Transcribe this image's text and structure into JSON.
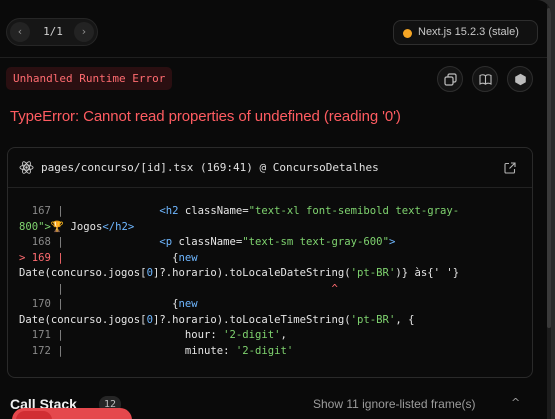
{
  "nav": {
    "prev_icon": "‹",
    "next_icon": "›",
    "page_count": "1/1"
  },
  "version": {
    "label": "Next.js 15.2.3 (stale)",
    "status_color": "#f5a524"
  },
  "error": {
    "badge": "Unhandled Runtime Error",
    "message": "TypeError: Cannot read properties of undefined (reading '0')"
  },
  "actions": {
    "copy_icon": "copy-icon",
    "docs_icon": "book-icon",
    "node_icon": "nodejs-icon"
  },
  "frame": {
    "path": "pages/concurso/[id].tsx (169:41) @ ConcursoDetalhes",
    "lines": [
      {
        "no": "  167 |",
        "segments": [
          {
            "t": "               ",
            "c": ""
          },
          {
            "t": "<h2 ",
            "c": "tag"
          },
          {
            "t": "className=",
            "c": ""
          },
          {
            "t": "\"text-xl font-semibold text-gray-",
            "c": "str"
          }
        ]
      },
      {
        "no": "",
        "segments": [
          {
            "t": "800\">",
            "c": "str"
          },
          {
            "t": "🏆 Jogos",
            "c": ""
          },
          {
            "t": "</h2>",
            "c": "tag"
          }
        ]
      },
      {
        "no": "  168 |",
        "segments": [
          {
            "t": "               ",
            "c": ""
          },
          {
            "t": "<p ",
            "c": "tag"
          },
          {
            "t": "className=",
            "c": ""
          },
          {
            "t": "\"text-sm text-gray-600\"",
            "c": "str"
          },
          {
            "t": ">",
            "c": "tag"
          }
        ]
      },
      {
        "no": "> 169 |",
        "segments": [
          {
            "t": "                 {",
            "c": ""
          },
          {
            "t": "new",
            "c": "tag"
          }
        ]
      },
      {
        "no": "",
        "segments": [
          {
            "t": "Date(concurso.jogos[",
            "c": ""
          },
          {
            "t": "0",
            "c": "pn"
          },
          {
            "t": "]?.horario).toLocaleDateString(",
            "c": ""
          },
          {
            "t": "'pt-BR'",
            "c": "str"
          },
          {
            "t": ")} às{' '}",
            "c": ""
          }
        ]
      },
      {
        "no": "      |",
        "segments": [
          {
            "t": "                                          ^",
            "c": "caret"
          }
        ]
      },
      {
        "no": "  170 |",
        "segments": [
          {
            "t": "                 {",
            "c": ""
          },
          {
            "t": "new",
            "c": "tag"
          }
        ]
      },
      {
        "no": "",
        "segments": [
          {
            "t": "Date(concurso.jogos[",
            "c": ""
          },
          {
            "t": "0",
            "c": "pn"
          },
          {
            "t": "]?.horario).toLocaleTimeString(",
            "c": ""
          },
          {
            "t": "'pt-BR'",
            "c": "str"
          },
          {
            "t": ", {",
            "c": ""
          }
        ]
      },
      {
        "no": "  171 |",
        "segments": [
          {
            "t": "                   hour: ",
            "c": ""
          },
          {
            "t": "'2-digit'",
            "c": "str"
          },
          {
            "t": ",",
            "c": ""
          }
        ]
      },
      {
        "no": "  172 |",
        "segments": [
          {
            "t": "                   minute: ",
            "c": ""
          },
          {
            "t": "'2-digit'",
            "c": "str"
          }
        ]
      }
    ]
  },
  "callstack": {
    "title": "Call Stack",
    "count": "12",
    "ignore_toggle": "Show 11 ignore-listed frame(s)",
    "ignore_chevron": "^"
  }
}
